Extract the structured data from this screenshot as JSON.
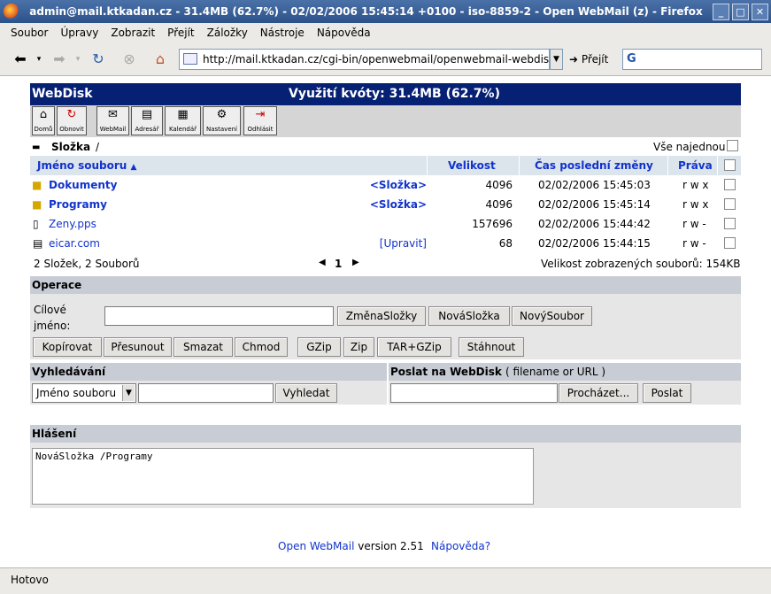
{
  "window": {
    "title": "admin@mail.ktkadan.cz - 31.4MB (62.7%) - 02/02/2006 15:45:14 +0100 - iso-8859-2 - Open WebMail (z) - Firefox"
  },
  "menu": [
    "Soubor",
    "Úpravy",
    "Zobrazit",
    "Přejít",
    "Záložky",
    "Nástroje",
    "Nápověda"
  ],
  "nav": {
    "url": "http://mail.ktkadan.cz/cgi-bin/openwebmail/openwebmail-webdisk.p",
    "go_label": "Přejít",
    "search_logo": "G"
  },
  "status": "Hotovo",
  "page": {
    "app_title": "WebDisk",
    "quota": "Využití kvóty: 31.4MB (62.7%)",
    "icon_buttons": [
      "Domů",
      "Obnovit",
      "WebMail",
      "Adresář",
      "Kalendář",
      "Nastavení",
      "Odhlásit"
    ],
    "folder_label": "Složka",
    "folder_path": "/",
    "select_all": "Vše najednou",
    "columns": {
      "name": "Jméno souboru",
      "size": "Velikost",
      "date": "Čas poslední změny",
      "perm": "Práva"
    },
    "files": [
      {
        "name": "Dokumenty",
        "action": "<Složka>",
        "size": "4096",
        "date": "02/02/2006 15:45:03",
        "perm": "r w x"
      },
      {
        "name": "Programy",
        "action": "<Složka>",
        "size": "4096",
        "date": "02/02/2006 15:45:14",
        "perm": "r w x"
      },
      {
        "name": "Zeny.pps",
        "action": "",
        "size": "157696",
        "date": "02/02/2006 15:44:42",
        "perm": "r w -"
      },
      {
        "name": "eicar.com",
        "action": "[Upravit]",
        "size": "68",
        "date": "02/02/2006 15:44:15",
        "perm": "r w -"
      }
    ],
    "summary": "2 Složek, 2 Souborů",
    "page_num": "1",
    "shown_size": "Velikost zobrazených souborů: 154KB",
    "operations_title": "Operace",
    "target_label": "Cílové jméno:",
    "target_buttons": [
      "ZměnaSložky",
      "NováSložka",
      "NovýSoubor"
    ],
    "op_buttons": [
      "Kopírovat",
      "Přesunout",
      "Smazat",
      "Chmod",
      "GZip",
      "Zip",
      "TAR+GZip",
      "Stáhnout"
    ],
    "search_title": "Vyhledávání",
    "search_select": "Jméno souboru",
    "search_button": "Vyhledat",
    "upload_title": "Poslat na WebDisk",
    "upload_hint": "( filename or URL )",
    "browse_button": "Procházet...",
    "send_button": "Poslat",
    "messages_title": "Hlášení",
    "messages_text": "NováSložka /Programy",
    "footer_app": "Open WebMail",
    "footer_version": "version 2.51",
    "footer_help": "Nápověda?"
  }
}
